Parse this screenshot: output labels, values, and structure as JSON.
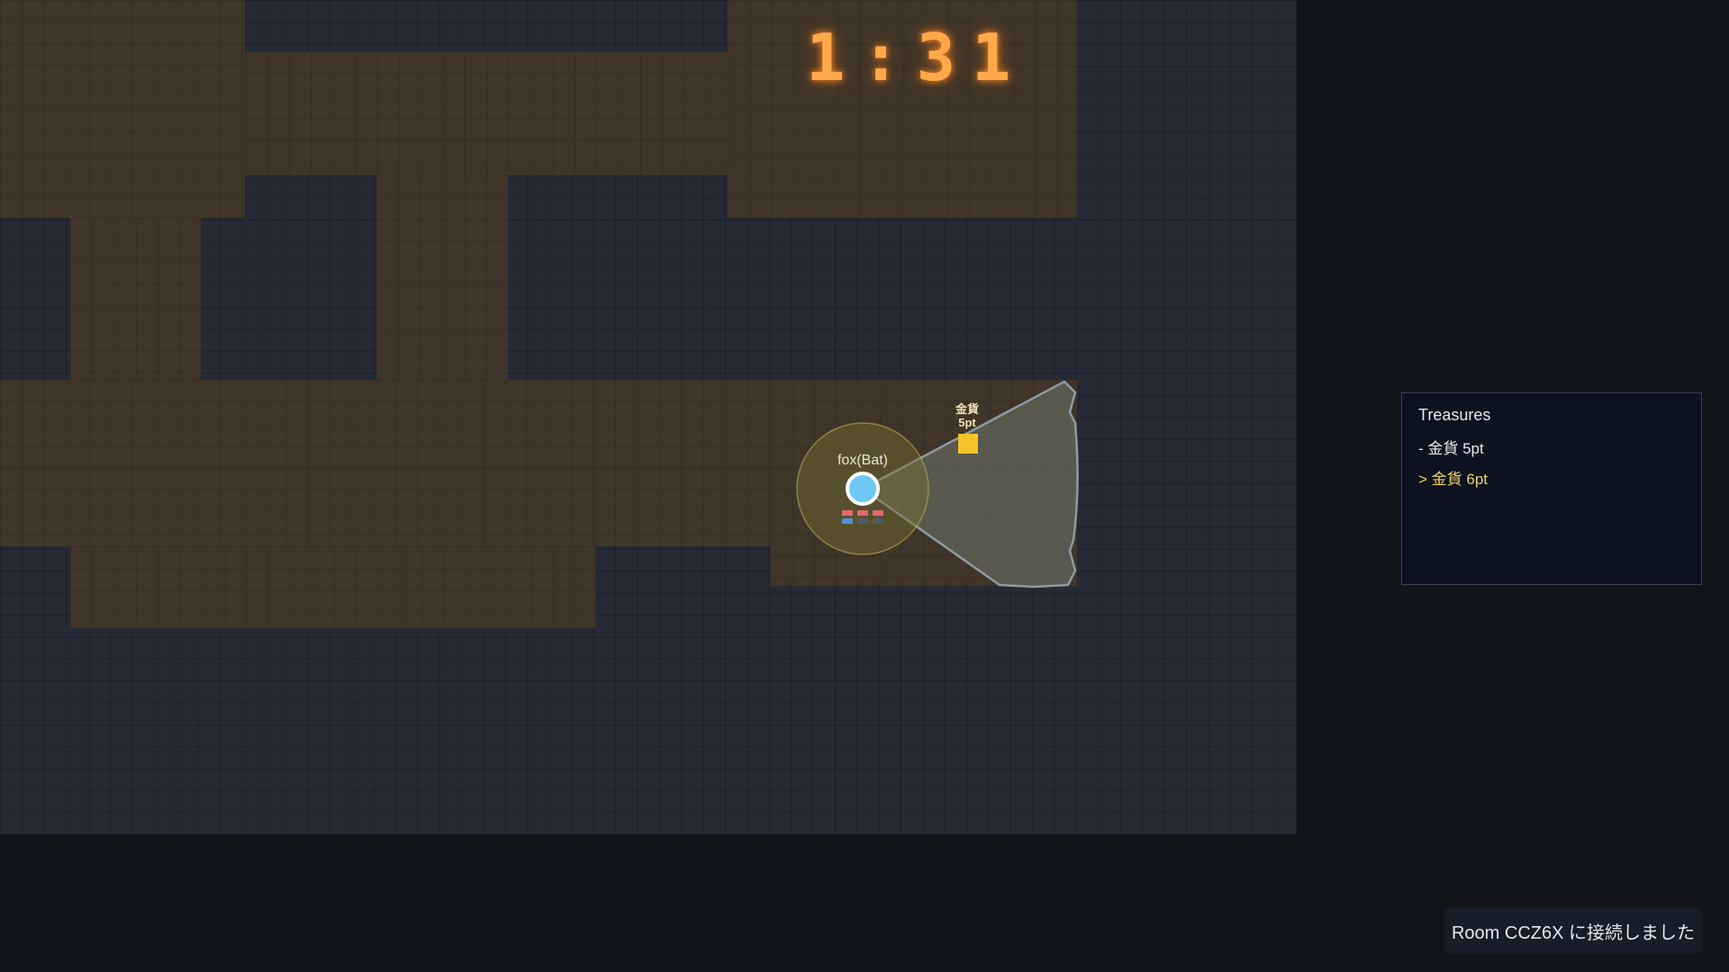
{
  "hud": {
    "timer": "1:31"
  },
  "player": {
    "name": "fox(Bat)",
    "color": "#6ec8f5"
  },
  "treasure_on_map": {
    "name": "金貨",
    "points": "5pt",
    "color": "#f5c22a"
  },
  "treasures_panel": {
    "title": "Treasures",
    "items": [
      {
        "label": "- 金貨 5pt",
        "current": false
      },
      {
        "label": "> 金貨 6pt",
        "current": true
      }
    ]
  },
  "toast": {
    "message": "Room CCZ6X に接続しました"
  },
  "colors": {
    "wall": "#262a35",
    "floor": "#3f3529",
    "background": "#11141a",
    "accent_timer": "#ffa94a",
    "current_treasure": "#f0d36a"
  }
}
